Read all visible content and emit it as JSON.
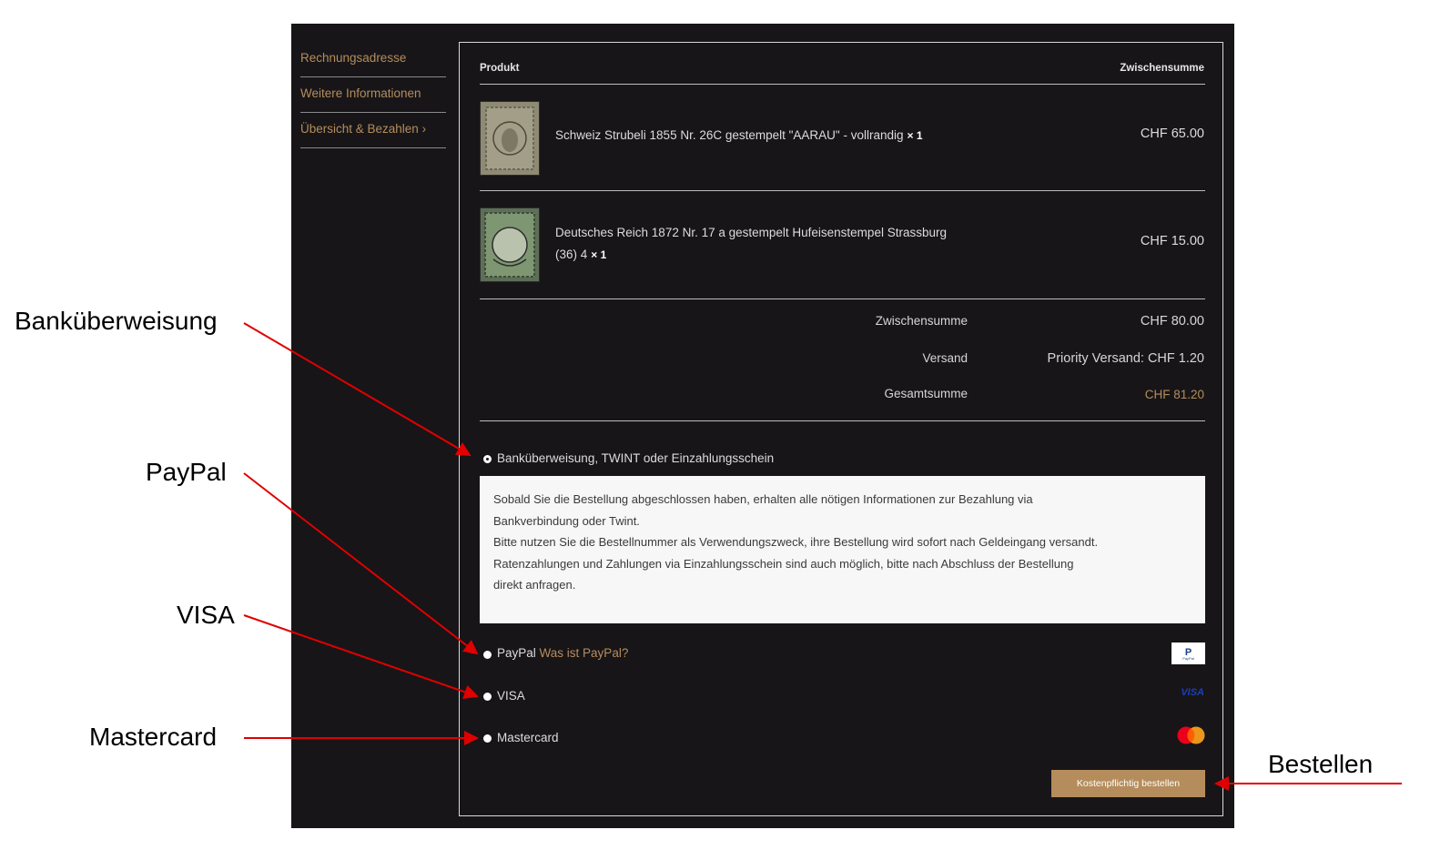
{
  "sidebar": {
    "items": [
      {
        "label": "Rechnungsadresse"
      },
      {
        "label": "Weitere Informationen"
      },
      {
        "label": "Übersicht & Bezahlen ›"
      }
    ]
  },
  "order": {
    "col_product": "Produkt",
    "col_subtotal": "Zwischensumme",
    "items": [
      {
        "name": "Schweiz Strubeli 1855 Nr. 26C gestempelt \"AARAU\" - vollrandig",
        "qty": "× 1",
        "price": "CHF 65.00"
      },
      {
        "name_line1": "Deutsches Reich 1872 Nr. 17 a gestempelt Hufeisenstempel Strassburg",
        "name_line2": "(36) 4",
        "qty": "× 1",
        "price": "CHF 15.00"
      }
    ],
    "totals": {
      "subtotal_label": "Zwischensumme",
      "subtotal_value": "CHF 80.00",
      "shipping_label": "Versand",
      "shipping_value": "Priority Versand: CHF 1.20",
      "total_label": "Gesamtsumme",
      "total_value": "CHF 81.20"
    }
  },
  "payment": {
    "bank_label": "Banküberweisung, TWINT oder Einzahlungsschein",
    "bank_info": {
      "line1": "Sobald Sie die Bestellung abgeschlossen haben, erhalten alle nötigen Informationen zur Bezahlung via",
      "line2": "Bankverbindung oder Twint.",
      "line3": "Bitte nutzen Sie die Bestellnummer als Verwendungszweck, ihre Bestellung wird sofort nach Geldeingang versandt.",
      "line4": "Ratenzahlungen und Zahlungen via Einzahlungsschein sind auch möglich, bitte nach Abschluss der Bestellung",
      "line5": "direkt anfragen."
    },
    "paypal_label": "PayPal",
    "paypal_link": "Was ist PayPal?",
    "paypal_logo_text": "PayPal",
    "visa_label": "VISA",
    "visa_logo_text": "VISA",
    "mastercard_label": "Mastercard",
    "order_button": "Kostenpflichtig bestellen"
  },
  "annotations": {
    "bank": "Banküberweisung",
    "paypal": "PayPal",
    "visa": "VISA",
    "mastercard": "Mastercard",
    "order": "Bestellen"
  },
  "colors": {
    "background": "#171518",
    "accent": "#b58d5c",
    "arrow": "#e00000"
  }
}
